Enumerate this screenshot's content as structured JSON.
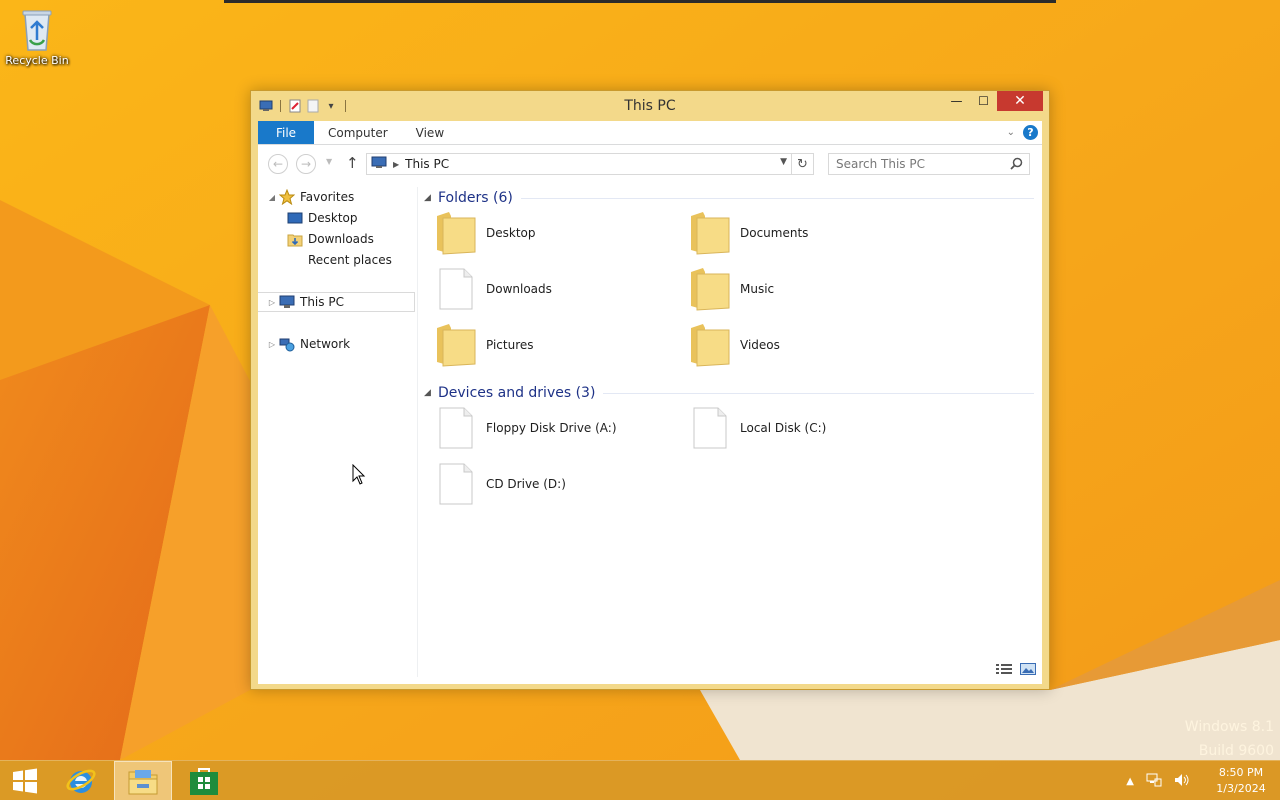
{
  "desktop": {
    "recycle_bin_label": "Recycle Bin",
    "watermark_line1": "Windows 8.1",
    "watermark_line2": "Build 9600"
  },
  "window": {
    "title": "This PC",
    "buttons": {
      "minimize": "—",
      "maximize": "☐",
      "close": "✕"
    }
  },
  "ribbon": {
    "tabs": [
      {
        "label": "File"
      },
      {
        "label": "Computer"
      },
      {
        "label": "View"
      }
    ]
  },
  "address_bar": {
    "path": "This PC",
    "search_placeholder": "Search This PC"
  },
  "nav_pane": {
    "favorites": "Favorites",
    "desktop": "Desktop",
    "downloads": "Downloads",
    "recent_places": "Recent places",
    "this_pc": "This PC",
    "network": "Network"
  },
  "content": {
    "folders_header": "Folders (6)",
    "folders": [
      {
        "name": "Desktop",
        "icon": "folder-icon"
      },
      {
        "name": "Documents",
        "icon": "folder-icon"
      },
      {
        "name": "Downloads",
        "icon": "file-icon"
      },
      {
        "name": "Music",
        "icon": "folder-icon"
      },
      {
        "name": "Pictures",
        "icon": "folder-icon"
      },
      {
        "name": "Videos",
        "icon": "folder-icon"
      }
    ],
    "drives_header": "Devices and drives (3)",
    "drives": [
      {
        "name": "Floppy Disk Drive (A:)",
        "icon": "file-icon"
      },
      {
        "name": "Local Disk (C:)",
        "icon": "file-icon"
      },
      {
        "name": "CD Drive (D:)",
        "icon": "file-icon"
      }
    ]
  },
  "taskbar": {
    "time": "8:50 PM",
    "date": "1/3/2024"
  },
  "colors": {
    "accent": "#1979ca",
    "close": "#c7392f",
    "group_header": "#1e3287",
    "window_frame": "#f3d98a"
  }
}
